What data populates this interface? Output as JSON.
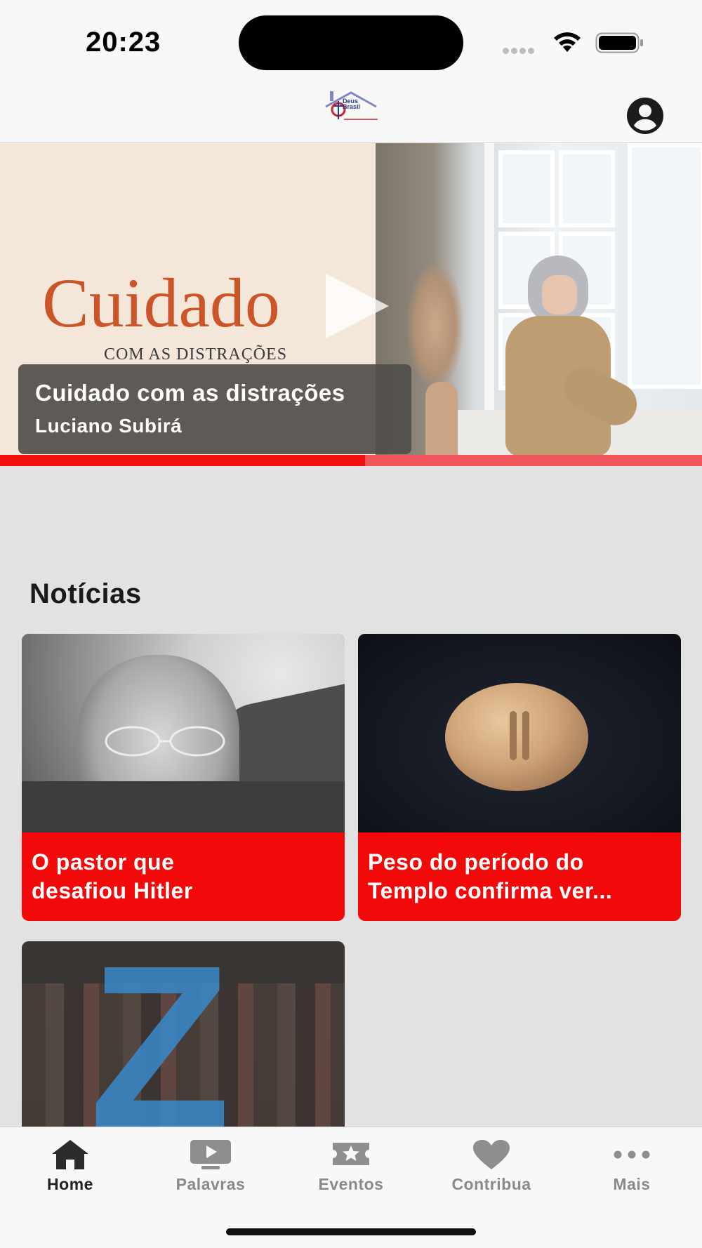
{
  "status_bar": {
    "time": "20:23"
  },
  "header": {
    "logo_alt": "Deus Brasil",
    "logo_line1": "Deus",
    "logo_line2": "Brasil"
  },
  "hero": {
    "art_title": "Cuidado",
    "art_subtitle": "COM AS DISTRAÇÕES",
    "title": "Cuidado com as distrações",
    "author": "Luciano Subirá",
    "progress": 0.52,
    "colors": {
      "progress_played": "#f20f0f",
      "progress_track": "#f0555b"
    }
  },
  "news": {
    "section_title": "Notícias",
    "items": [
      {
        "title_line1": "O pastor que",
        "title_line2": "desafiou Hitler",
        "image": "portrait-photo"
      },
      {
        "title_line1": "Peso do período do",
        "title_line2": "Templo confirma ver...",
        "image": "stone-weight-photo"
      },
      {
        "image": "generation-z-photo"
      }
    ],
    "card_color": "#f20a0a"
  },
  "tabs": [
    {
      "label": "Home",
      "icon": "home-icon",
      "active": true
    },
    {
      "label": "Palavras",
      "icon": "video-icon",
      "active": false
    },
    {
      "label": "Eventos",
      "icon": "ticket-star-icon",
      "active": false
    },
    {
      "label": "Contribua",
      "icon": "heart-icon",
      "active": false
    },
    {
      "label": "Mais",
      "icon": "more-icon",
      "active": false
    }
  ]
}
